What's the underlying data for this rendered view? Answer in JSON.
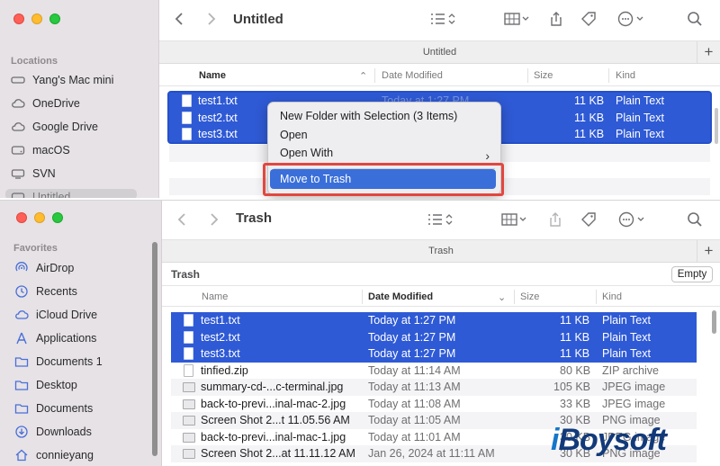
{
  "top_window": {
    "title": "Untitled",
    "tab": "Untitled",
    "sidebar": {
      "section": "Locations",
      "items": [
        {
          "label": "Yang's Mac mini",
          "icon": "mac-mini-icon"
        },
        {
          "label": "OneDrive",
          "icon": "cloud-icon"
        },
        {
          "label": "Google Drive",
          "icon": "cloud-icon"
        },
        {
          "label": "macOS",
          "icon": "disk-icon"
        },
        {
          "label": "SVN",
          "icon": "network-drive-icon"
        },
        {
          "label": "Untitled",
          "icon": "disk-icon"
        }
      ]
    },
    "columns": [
      "Name",
      "Date Modified",
      "Size",
      "Kind"
    ],
    "files": [
      {
        "name": "test1.txt",
        "date": "Today at 1:27 PM",
        "size": "11 KB",
        "kind": "Plain Text"
      },
      {
        "name": "test2.txt",
        "date": "",
        "size": "11 KB",
        "kind": "Plain Text"
      },
      {
        "name": "test3.txt",
        "date": "",
        "size": "11 KB",
        "kind": "Plain Text"
      }
    ],
    "context_menu": {
      "items": [
        "New Folder with Selection (3 Items)",
        "Open",
        "Open With"
      ],
      "highlighted": "Move to Trash"
    }
  },
  "bottom_window": {
    "title": "Trash",
    "tab": "Trash",
    "path_label": "Trash",
    "empty_button": "Empty",
    "sidebar": {
      "section": "Favorites",
      "items": [
        {
          "label": "AirDrop",
          "icon": "airdrop-icon"
        },
        {
          "label": "Recents",
          "icon": "clock-icon"
        },
        {
          "label": "iCloud Drive",
          "icon": "cloud-icon"
        },
        {
          "label": "Applications",
          "icon": "applications-icon"
        },
        {
          "label": "Documents 1",
          "icon": "folder-icon"
        },
        {
          "label": "Desktop",
          "icon": "folder-icon"
        },
        {
          "label": "Documents",
          "icon": "folder-icon"
        },
        {
          "label": "Downloads",
          "icon": "download-icon"
        },
        {
          "label": "connieyang",
          "icon": "home-icon"
        }
      ]
    },
    "columns": [
      "Name",
      "Date Modified",
      "Size",
      "Kind"
    ],
    "files": [
      {
        "name": "test1.txt",
        "date": "Today at 1:27 PM",
        "size": "11 KB",
        "kind": "Plain Text",
        "selected": true
      },
      {
        "name": "test2.txt",
        "date": "Today at 1:27 PM",
        "size": "11 KB",
        "kind": "Plain Text",
        "selected": true
      },
      {
        "name": "test3.txt",
        "date": "Today at 1:27 PM",
        "size": "11 KB",
        "kind": "Plain Text",
        "selected": true
      },
      {
        "name": "tinfied.zip",
        "date": "Today at 11:14 AM",
        "size": "80 KB",
        "kind": "ZIP archive",
        "selected": false
      },
      {
        "name": "summary-cd-...c-terminal.jpg",
        "date": "Today at 11:13 AM",
        "size": "105 KB",
        "kind": "JPEG image",
        "selected": false
      },
      {
        "name": "back-to-previ...inal-mac-2.jpg",
        "date": "Today at 11:08 AM",
        "size": "33 KB",
        "kind": "JPEG image",
        "selected": false
      },
      {
        "name": "Screen Shot 2...t 11.05.56 AM",
        "date": "Today at 11:05 AM",
        "size": "30 KB",
        "kind": "PNG image",
        "selected": false
      },
      {
        "name": "back-to-previ...inal-mac-1.jpg",
        "date": "Today at 11:01 AM",
        "size": "30 KB",
        "kind": "JPEG image",
        "selected": false
      },
      {
        "name": "Screen Shot 2...at 11.11.12 AM",
        "date": "Jan 26, 2024 at 11:11 AM",
        "size": "30 KB",
        "kind": "PNG image",
        "selected": false
      }
    ]
  },
  "watermark": "iBoysoft",
  "colors": {
    "selection": "#2f5ad5",
    "highlight_border": "#e2473f",
    "accent": "#3a6fd9"
  }
}
